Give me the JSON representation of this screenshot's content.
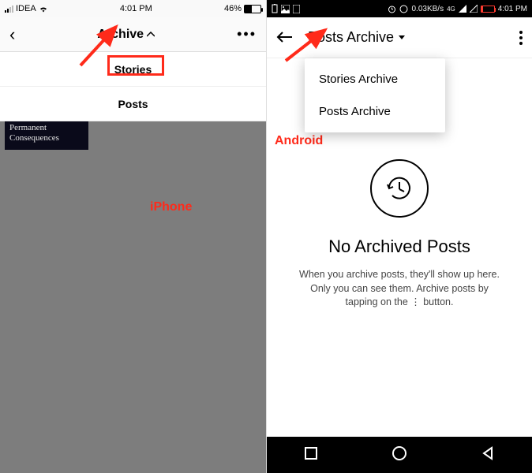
{
  "ios": {
    "carrier": "IDEA",
    "time": "4:01 PM",
    "battery_pct": "46%",
    "header_title": "Archive",
    "dropdown": {
      "stories": "Stories",
      "posts": "Posts"
    },
    "card_line1": "Permanent",
    "card_line2": "Consequences",
    "annotation": "iPhone"
  },
  "android": {
    "net_speed": "0.03KB/s",
    "net_label": "4G",
    "time": "4:01 PM",
    "header_title": "Posts Archive",
    "menu": {
      "stories": "Stories Archive",
      "posts": "Posts Archive"
    },
    "empty_title": "No Archived Posts",
    "empty_desc_l1": "When you archive posts, they'll show up here.",
    "empty_desc_l2": "Only you can see them. Archive posts by",
    "empty_desc_l3": "tapping on the  ⋮  button.",
    "annotation": "Android"
  }
}
